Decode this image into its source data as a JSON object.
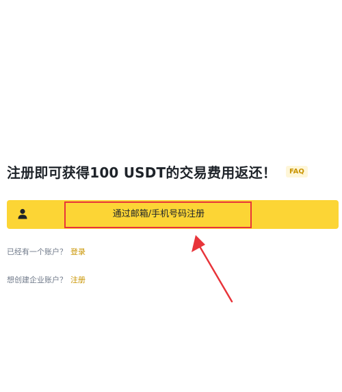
{
  "headline": {
    "text": "注册即可获得100 USDT的交易费用返还！",
    "faq_label": "FAQ"
  },
  "register_bar": {
    "label": "通过邮箱/手机号码注册",
    "icon": "user-icon",
    "color": "#fcd535"
  },
  "login_row": {
    "prompt": "已经有一个账户？",
    "link": "登录"
  },
  "enterprise_row": {
    "prompt": "想创建企业账户？",
    "link": "注册"
  },
  "annotation": {
    "highlight_color": "#e8343a",
    "arrow_icon": "arrow-pointer-icon"
  }
}
